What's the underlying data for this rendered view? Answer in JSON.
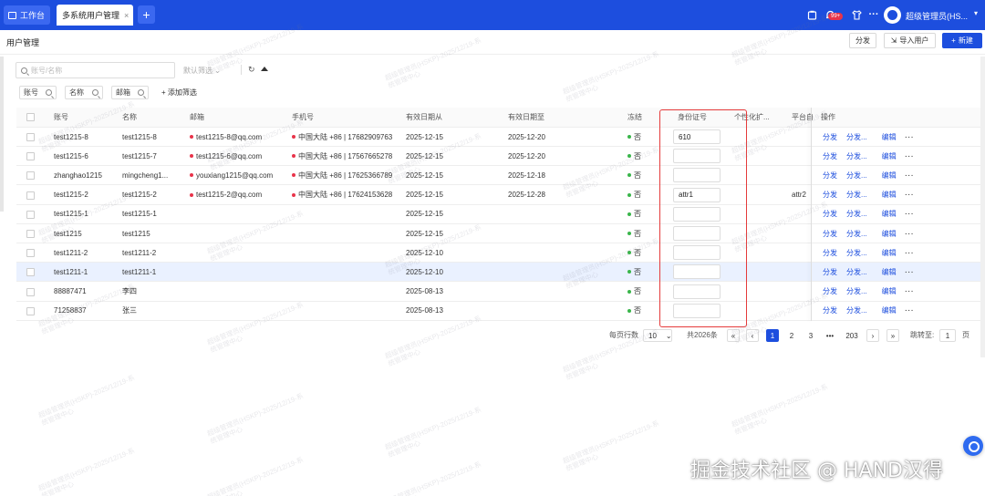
{
  "topbar": {
    "home_tab": "工作台",
    "active_tab": "多系统用户管理",
    "active_tab_close": "×",
    "add_tab": "+",
    "notification_badge": "99+",
    "user_name": "超级管理员(HS...",
    "icons": [
      "task-icon",
      "bell-icon",
      "shirt-icon",
      "more-icon"
    ]
  },
  "page": {
    "title": "用户管理",
    "buttons": {
      "distribute": "分发",
      "import": "导入用户",
      "create": "新建"
    }
  },
  "filters": {
    "search_placeholder": "账号/名称",
    "preset": "默认筛选",
    "chips": [
      "账号",
      "名称",
      "邮箱"
    ],
    "add_filter": "添加筛选"
  },
  "table": {
    "columns": [
      "账号",
      "名称",
      "邮箱",
      "手机号",
      "有效日期从",
      "有效日期至",
      "冻结",
      "身份证号",
      "个性化扩...",
      "平台自",
      "操作"
    ],
    "actions": {
      "distribute": "分发",
      "distribute_more": "分发...",
      "edit": "编辑",
      "more": "···"
    },
    "rows": [
      {
        "account": "test1215-8",
        "name": "test1215-8",
        "email": "test1215-8@qq.com",
        "phone": "中国大陆 +86 | 17682909763",
        "from": "2025-12-15",
        "to": "2025-12-20",
        "frozen": "否",
        "idcard": "610",
        "attr": ""
      },
      {
        "account": "test1215-6",
        "name": "test1215-7",
        "email": "test1215-6@qq.com",
        "phone": "中国大陆 +86 | 17567665278",
        "from": "2025-12-15",
        "to": "2025-12-20",
        "frozen": "否",
        "idcard": "",
        "attr": ""
      },
      {
        "account": "zhanghao1215",
        "name": "mingcheng1...",
        "email": "youxiang1215@qq.com",
        "phone": "中国大陆 +86 | 17625366789",
        "from": "2025-12-15",
        "to": "2025-12-18",
        "frozen": "否",
        "idcard": "",
        "attr": ""
      },
      {
        "account": "test1215-2",
        "name": "test1215-2",
        "email": "test1215-2@qq.com",
        "phone": "中国大陆 +86 | 17624153628",
        "from": "2025-12-15",
        "to": "2025-12-28",
        "frozen": "否",
        "idcard": "attr1",
        "attr": "attr2"
      },
      {
        "account": "test1215-1",
        "name": "test1215-1",
        "email": "",
        "phone": "",
        "from": "2025-12-15",
        "to": "",
        "frozen": "否",
        "idcard": "",
        "attr": ""
      },
      {
        "account": "test1215",
        "name": "test1215",
        "email": "",
        "phone": "",
        "from": "2025-12-15",
        "to": "",
        "frozen": "否",
        "idcard": "",
        "attr": ""
      },
      {
        "account": "test1211-2",
        "name": "test1211-2",
        "email": "",
        "phone": "",
        "from": "2025-12-10",
        "to": "",
        "frozen": "否",
        "idcard": "",
        "attr": ""
      },
      {
        "account": "test1211-1",
        "name": "test1211-1",
        "email": "",
        "phone": "",
        "from": "2025-12-10",
        "to": "",
        "frozen": "否",
        "idcard": "",
        "attr": ""
      },
      {
        "account": "88887471",
        "name": "李四",
        "email": "",
        "phone": "",
        "from": "2025-08-13",
        "to": "",
        "frozen": "否",
        "idcard": "",
        "attr": ""
      },
      {
        "account": "71258837",
        "name": "张三",
        "email": "",
        "phone": "",
        "from": "2025-08-13",
        "to": "",
        "frozen": "否",
        "idcard": "",
        "attr": ""
      }
    ],
    "selected_row_index": 7
  },
  "pagination": {
    "per_page_label": "每页行数",
    "per_page": "10",
    "total": "共2026条",
    "pages": [
      "1",
      "2",
      "3",
      "•••",
      "203"
    ],
    "jump_label": "跳转至",
    "jump_value": "1",
    "page_unit": "页"
  },
  "watermark": {
    "line1": "超级管理员(HSKP)-2025/12/19-系",
    "line2": "统管理中心"
  },
  "brand": "掘金技术社区 @ HAND汉得",
  "colors": {
    "primary": "#1d4ede",
    "danger": "#e8334a",
    "success": "#39b54a",
    "highlight_frame": "#e53b3b"
  }
}
